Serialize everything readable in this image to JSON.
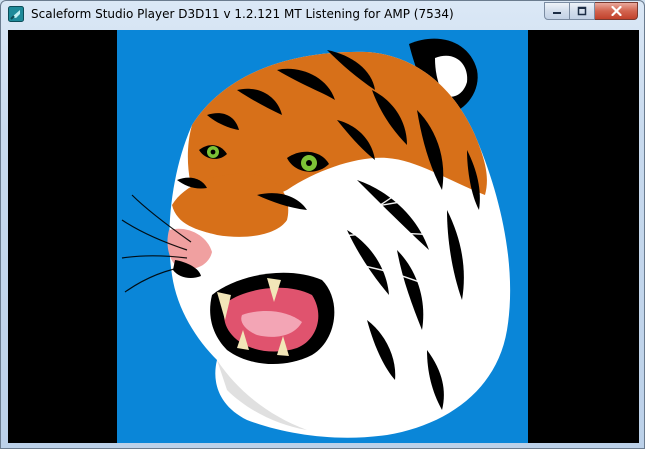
{
  "window": {
    "title": "Scaleform Studio Player D3D11 v 1.2.121  MT  Listening for AMP (7534)",
    "icon": "scaleform-app-icon",
    "controls": [
      "minimize",
      "maximize",
      "close"
    ]
  },
  "content": {
    "image": "tiger-head-illustration",
    "stage_background": "#0a86d8",
    "letterbox_color": "#000000"
  }
}
